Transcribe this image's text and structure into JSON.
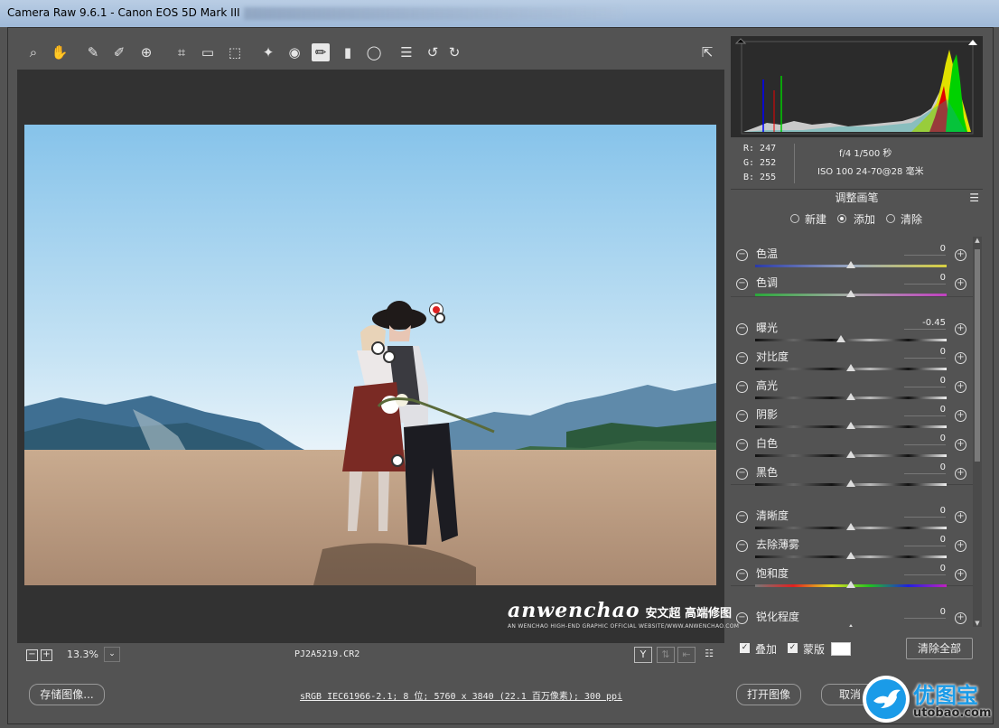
{
  "window": {
    "title": "Camera Raw 9.6.1 -  Canon EOS 5D Mark III"
  },
  "toolbar": {
    "tools": [
      {
        "name": "zoom-tool-icon",
        "glyph": "⌕"
      },
      {
        "name": "hand-tool-icon",
        "glyph": "✋"
      },
      {
        "name": "white-balance-tool-icon",
        "glyph": "✎"
      },
      {
        "name": "color-sampler-icon",
        "glyph": "✐"
      },
      {
        "name": "targeted-adjustment-icon",
        "glyph": "⊕"
      },
      {
        "name": "crop-tool-icon",
        "glyph": "⌗"
      },
      {
        "name": "straighten-tool-icon",
        "glyph": "▭"
      },
      {
        "name": "transform-tool-icon",
        "glyph": "⬚"
      },
      {
        "name": "spot-removal-icon",
        "glyph": "✦"
      },
      {
        "name": "red-eye-icon",
        "glyph": "◉"
      },
      {
        "name": "adjustment-brush-icon",
        "glyph": "✏"
      },
      {
        "name": "graduated-filter-icon",
        "glyph": "▮"
      },
      {
        "name": "radial-filter-icon",
        "glyph": "◯"
      },
      {
        "name": "preferences-icon",
        "glyph": "☰"
      },
      {
        "name": "rotate-left-icon",
        "glyph": "↺"
      },
      {
        "name": "rotate-right-icon",
        "glyph": "↻"
      }
    ]
  },
  "status": {
    "zoom_minus": "−",
    "zoom_plus": "+",
    "zoom": "13.3%",
    "zoom_dropdown": "⌄",
    "filename": "PJ2A5219.CR2"
  },
  "watermark": {
    "brand": "anwenchao",
    "cn": "安文超 高端修图",
    "sub": "AN WENCHAO HIGH-END GRAPHIC OFFICIAL WEBSITE/WWW.ANWENCHAO.COM"
  },
  "readout": {
    "r": "R:  247",
    "g": "G:  252",
    "b": "B:  255",
    "exposure": "f/4   1/500 秒",
    "iso_lens": "ISO 100   24-70@28 毫米"
  },
  "panel": {
    "title": "调整画笔",
    "modes": [
      "新建",
      "添加",
      "清除"
    ],
    "sliders": [
      {
        "label": "色温",
        "value": "0",
        "pos": 0.5,
        "track": "temp"
      },
      {
        "label": "色调",
        "value": "0",
        "pos": 0.5,
        "track": "tint"
      },
      {
        "label": "曝光",
        "value": "-0.45",
        "pos": 0.45,
        "track": "gray"
      },
      {
        "label": "对比度",
        "value": "0",
        "pos": 0.5,
        "track": "gray"
      },
      {
        "label": "高光",
        "value": "0",
        "pos": 0.5,
        "track": "gray"
      },
      {
        "label": "阴影",
        "value": "0",
        "pos": 0.5,
        "track": "gray"
      },
      {
        "label": "白色",
        "value": "0",
        "pos": 0.5,
        "track": "gray"
      },
      {
        "label": "黑色",
        "value": "0",
        "pos": 0.5,
        "track": "gray"
      },
      {
        "label": "清晰度",
        "value": "0",
        "pos": 0.5,
        "track": "gray"
      },
      {
        "label": "去除薄雾",
        "value": "0",
        "pos": 0.5,
        "track": "gray"
      },
      {
        "label": "饱和度",
        "value": "0",
        "pos": 0.5,
        "track": "sat"
      },
      {
        "label": "锐化程度",
        "value": "0",
        "pos": 0.5,
        "track": "gray"
      }
    ],
    "overlay_label": "叠加",
    "mask_label": "蒙版",
    "clear_all": "清除全部"
  },
  "footer": {
    "save": "存储图像...",
    "workflow": "sRGB IEC61966-2.1; 8 位; 5760 x 3840 (22.1 百万像素); 300 ppi",
    "open": "打开图像",
    "cancel": "取消"
  },
  "logo": {
    "text": "优图宝",
    "url": "utobao.com"
  },
  "colors": {
    "accent": "#1a9be8",
    "panel": "#535353",
    "viewer": "#323232"
  }
}
